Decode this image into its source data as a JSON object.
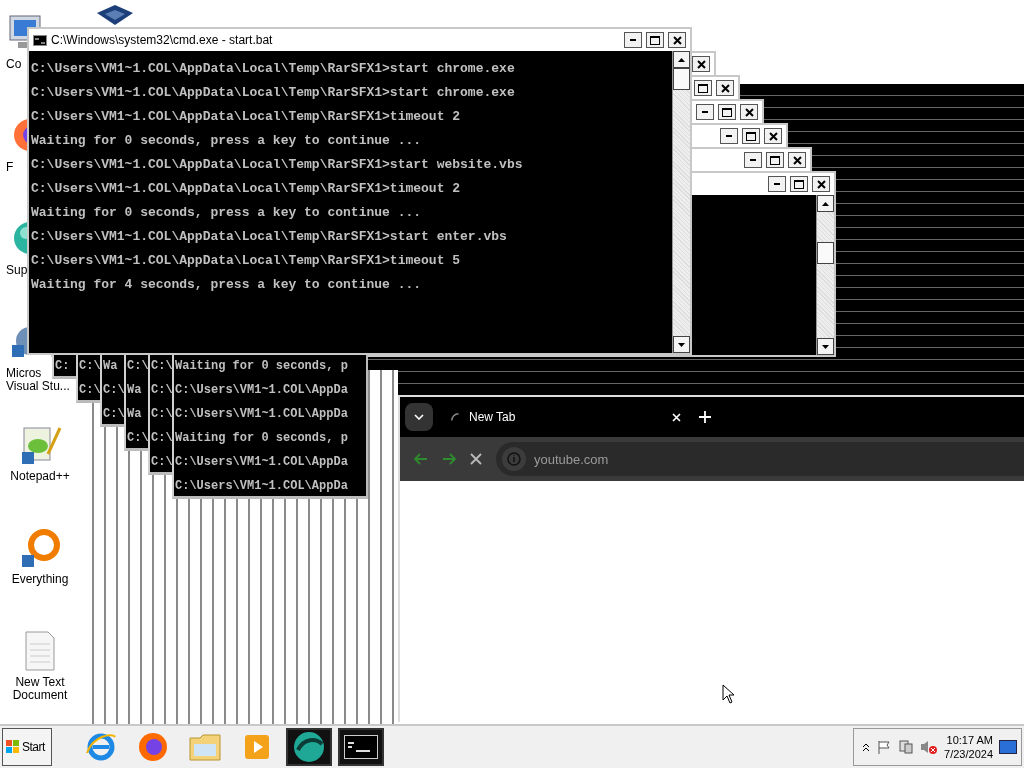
{
  "desktop_icons": [
    {
      "kind": "computer",
      "lines": [
        "Co"
      ],
      "covered": true
    },
    {
      "kind": "firefox",
      "lines": [
        "F"
      ],
      "covered": true
    },
    {
      "kind": "support",
      "lines": [
        "Sup"
      ],
      "covered": true
    },
    {
      "kind": "visual-studio",
      "lines": [
        "Micros",
        "Visual Stu..."
      ],
      "covered": true
    },
    {
      "kind": "notepad",
      "lines": [
        "Notepad++"
      ],
      "covered": false
    },
    {
      "kind": "everything",
      "lines": [
        "Everything"
      ],
      "covered": false
    },
    {
      "kind": "text-file",
      "lines": [
        "New Text",
        "Document"
      ],
      "covered": false
    }
  ],
  "console": {
    "title": "C:\\Windows\\system32\\cmd.exe - start.bat",
    "lines": [
      "C:\\Users\\VM1~1.COL\\AppData\\Local\\Temp\\RarSFX1>start chrome.exe",
      "C:\\Users\\VM1~1.COL\\AppData\\Local\\Temp\\RarSFX1>start chrome.exe",
      "C:\\Users\\VM1~1.COL\\AppData\\Local\\Temp\\RarSFX1>timeout 2",
      "Waiting for 0 seconds, press a key to continue ...",
      "C:\\Users\\VM1~1.COL\\AppData\\Local\\Temp\\RarSFX1>start website.vbs",
      "C:\\Users\\VM1~1.COL\\AppData\\Local\\Temp\\RarSFX1>timeout 2",
      "Waiting for 0 seconds, press a key to continue ...",
      "C:\\Users\\VM1~1.COL\\AppData\\Local\\Temp\\RarSFX1>start enter.vbs",
      "C:\\Users\\VM1~1.COL\\AppData\\Local\\Temp\\RarSFX1>timeout 5",
      "Waiting for 4 seconds, press a key to continue ..."
    ]
  },
  "console_fragments": [
    {
      "lines": [
        "C:"
      ]
    },
    {
      "lines": [
        "C:\\",
        "C:\\"
      ]
    },
    {
      "lines": [
        "Wa",
        "C:\\",
        "C:\\"
      ]
    },
    {
      "lines": [
        "C:\\",
        "Wa",
        "Wa",
        "C:\\"
      ]
    },
    {
      "lines": [
        "C:\\",
        "C:\\",
        "C:\\",
        "C:\\",
        "C:\\"
      ]
    },
    {
      "lines": [
        "Waiting for 0 seconds, p",
        "C:\\Users\\VM1~1.COL\\AppDa",
        "C:\\Users\\VM1~1.COL\\AppDa",
        "Waiting for 0 seconds, p",
        "C:\\Users\\VM1~1.COL\\AppDa",
        "C:\\Users\\VM1~1.COL\\AppDa"
      ]
    }
  ],
  "browser": {
    "tabs": [
      {
        "title": "New Tab",
        "selected": true,
        "loading": true
      }
    ],
    "address": "youtube.com"
  },
  "taskbar": {
    "start": "Start",
    "apps": [
      {
        "kind": "ie",
        "selected": false
      },
      {
        "kind": "firefox",
        "selected": false
      },
      {
        "kind": "folder",
        "selected": false
      },
      {
        "kind": "media",
        "selected": false
      },
      {
        "kind": "sphere",
        "selected": true
      },
      {
        "kind": "console",
        "selected": true
      }
    ],
    "clock": {
      "time": "10:17 AM",
      "date": "7/23/2024"
    }
  }
}
